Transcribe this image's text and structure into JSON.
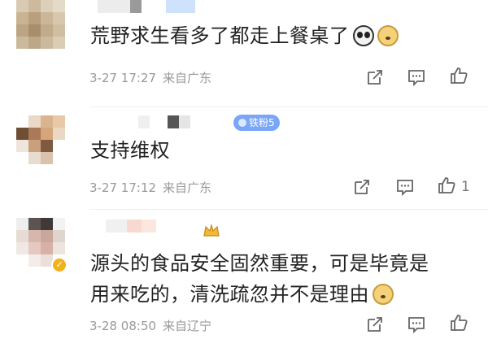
{
  "comments": [
    {
      "text": "荒野求生看多了都走上餐桌了",
      "emojis": [
        "panda-face-icon",
        "doge-icon"
      ],
      "date": "3-27 17:27",
      "location": "来自广东",
      "likes": "",
      "badge": ""
    },
    {
      "text": "支持维权",
      "emojis": [],
      "date": "3-27 17:12",
      "location": "来自广东",
      "likes": "1",
      "badge": "铁粉5"
    },
    {
      "text_lines": [
        "源头的食品安全固然重要，可是毕竟是",
        "用来吃的，清洗疏忽并不是理由"
      ],
      "emojis": [
        "doge-icon"
      ],
      "date": "3-28 08:50",
      "location": "来自辽宁",
      "likes": "",
      "badge": ""
    }
  ],
  "colors": {
    "text": "#222222",
    "meta": "#999999",
    "badge": "#7aa6f7",
    "icon": "#666666",
    "verified": "#f3b21c"
  }
}
